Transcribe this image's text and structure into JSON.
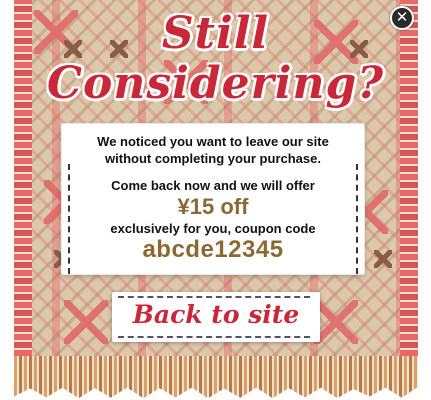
{
  "popup": {
    "title_line1": "Still",
    "title_line2": "Considering?",
    "close_glyph": "✕",
    "message_line1": "We noticed you want to leave our site",
    "message_line2": "without completing your purchase.",
    "offer_line": "Come back now and we will offer",
    "discount": "¥15 off",
    "coupon_line": "exclusively for you, coupon code",
    "coupon_code": "abcde12345",
    "back_button_label": "Back to site"
  },
  "colors": {
    "title_red": "#c8283a",
    "accent_brown": "#8a6a32",
    "rug_base": "#dcc8aa"
  },
  "icons": {
    "close": "close-icon"
  }
}
